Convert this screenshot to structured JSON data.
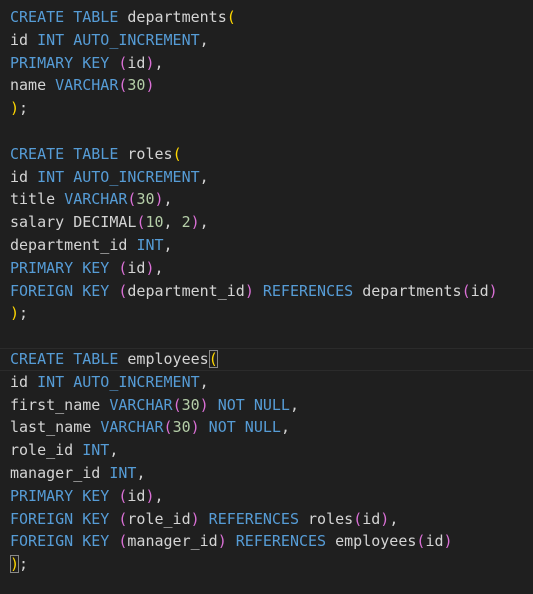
{
  "editor": {
    "language": "SQL",
    "theme": "Dark Modern",
    "current_line_index": 15,
    "lines": [
      [
        {
          "t": "CREATE TABLE ",
          "c": "kw"
        },
        {
          "t": "departments",
          "c": "plain"
        },
        {
          "t": "(",
          "c": "p1"
        }
      ],
      [
        {
          "t": "id ",
          "c": "plain"
        },
        {
          "t": "INT AUTO_INCREMENT",
          "c": "kw"
        },
        {
          "t": ",",
          "c": "plain"
        }
      ],
      [
        {
          "t": "PRIMARY KEY ",
          "c": "kw"
        },
        {
          "t": "(",
          "c": "p2"
        },
        {
          "t": "id",
          "c": "plain"
        },
        {
          "t": ")",
          "c": "p2"
        },
        {
          "t": ",",
          "c": "plain"
        }
      ],
      [
        {
          "t": "name ",
          "c": "plain"
        },
        {
          "t": "VARCHAR",
          "c": "kw"
        },
        {
          "t": "(",
          "c": "p2"
        },
        {
          "t": "30",
          "c": "num"
        },
        {
          "t": ")",
          "c": "p2"
        }
      ],
      [
        {
          "t": ")",
          "c": "p1"
        },
        {
          "t": ";",
          "c": "plain"
        }
      ],
      [],
      [
        {
          "t": "CREATE TABLE ",
          "c": "kw"
        },
        {
          "t": "roles",
          "c": "plain"
        },
        {
          "t": "(",
          "c": "p1"
        }
      ],
      [
        {
          "t": "id ",
          "c": "plain"
        },
        {
          "t": "INT AUTO_INCREMENT",
          "c": "kw"
        },
        {
          "t": ",",
          "c": "plain"
        }
      ],
      [
        {
          "t": "title ",
          "c": "plain"
        },
        {
          "t": "VARCHAR",
          "c": "kw"
        },
        {
          "t": "(",
          "c": "p2"
        },
        {
          "t": "30",
          "c": "num"
        },
        {
          "t": ")",
          "c": "p2"
        },
        {
          "t": ",",
          "c": "plain"
        }
      ],
      [
        {
          "t": "salary DECIMAL",
          "c": "plain"
        },
        {
          "t": "(",
          "c": "p2"
        },
        {
          "t": "10",
          "c": "num"
        },
        {
          "t": ", ",
          "c": "plain"
        },
        {
          "t": "2",
          "c": "num"
        },
        {
          "t": ")",
          "c": "p2"
        },
        {
          "t": ",",
          "c": "plain"
        }
      ],
      [
        {
          "t": "department_id ",
          "c": "plain"
        },
        {
          "t": "INT",
          "c": "kw"
        },
        {
          "t": ",",
          "c": "plain"
        }
      ],
      [
        {
          "t": "PRIMARY KEY ",
          "c": "kw"
        },
        {
          "t": "(",
          "c": "p2"
        },
        {
          "t": "id",
          "c": "plain"
        },
        {
          "t": ")",
          "c": "p2"
        },
        {
          "t": ",",
          "c": "plain"
        }
      ],
      [
        {
          "t": "FOREIGN KEY ",
          "c": "kw"
        },
        {
          "t": "(",
          "c": "p2"
        },
        {
          "t": "department_id",
          "c": "plain"
        },
        {
          "t": ")",
          "c": "p2"
        },
        {
          "t": " REFERENCES ",
          "c": "kw"
        },
        {
          "t": "departments",
          "c": "plain"
        },
        {
          "t": "(",
          "c": "p2"
        },
        {
          "t": "id",
          "c": "plain"
        },
        {
          "t": ")",
          "c": "p2"
        }
      ],
      [
        {
          "t": ")",
          "c": "p1"
        },
        {
          "t": ";",
          "c": "plain"
        }
      ],
      [],
      [
        {
          "t": "CREATE TABLE ",
          "c": "kw"
        },
        {
          "t": "employees",
          "c": "plain"
        },
        {
          "t": "(",
          "c": "p1",
          "m": 1
        }
      ],
      [
        {
          "t": "id ",
          "c": "plain"
        },
        {
          "t": "INT AUTO_INCREMENT",
          "c": "kw"
        },
        {
          "t": ",",
          "c": "plain"
        }
      ],
      [
        {
          "t": "first_name ",
          "c": "plain"
        },
        {
          "t": "VARCHAR",
          "c": "kw"
        },
        {
          "t": "(",
          "c": "p2"
        },
        {
          "t": "30",
          "c": "num"
        },
        {
          "t": ")",
          "c": "p2"
        },
        {
          "t": " NOT NULL",
          "c": "kw"
        },
        {
          "t": ",",
          "c": "plain"
        }
      ],
      [
        {
          "t": "last_name ",
          "c": "plain"
        },
        {
          "t": "VARCHAR",
          "c": "kw"
        },
        {
          "t": "(",
          "c": "p2"
        },
        {
          "t": "30",
          "c": "num"
        },
        {
          "t": ")",
          "c": "p2"
        },
        {
          "t": " NOT NULL",
          "c": "kw"
        },
        {
          "t": ",",
          "c": "plain"
        }
      ],
      [
        {
          "t": "role_id ",
          "c": "plain"
        },
        {
          "t": "INT",
          "c": "kw"
        },
        {
          "t": ",",
          "c": "plain"
        }
      ],
      [
        {
          "t": "manager_id ",
          "c": "plain"
        },
        {
          "t": "INT",
          "c": "kw"
        },
        {
          "t": ",",
          "c": "plain"
        }
      ],
      [
        {
          "t": "PRIMARY KEY ",
          "c": "kw"
        },
        {
          "t": "(",
          "c": "p2"
        },
        {
          "t": "id",
          "c": "plain"
        },
        {
          "t": ")",
          "c": "p2"
        },
        {
          "t": ",",
          "c": "plain"
        }
      ],
      [
        {
          "t": "FOREIGN KEY ",
          "c": "kw"
        },
        {
          "t": "(",
          "c": "p2"
        },
        {
          "t": "role_id",
          "c": "plain"
        },
        {
          "t": ")",
          "c": "p2"
        },
        {
          "t": " REFERENCES ",
          "c": "kw"
        },
        {
          "t": "roles",
          "c": "plain"
        },
        {
          "t": "(",
          "c": "p2"
        },
        {
          "t": "id",
          "c": "plain"
        },
        {
          "t": ")",
          "c": "p2"
        },
        {
          "t": ",",
          "c": "plain"
        }
      ],
      [
        {
          "t": "FOREIGN KEY ",
          "c": "kw"
        },
        {
          "t": "(",
          "c": "p2"
        },
        {
          "t": "manager_id",
          "c": "plain"
        },
        {
          "t": ")",
          "c": "p2"
        },
        {
          "t": " REFERENCES ",
          "c": "kw"
        },
        {
          "t": "employees",
          "c": "plain"
        },
        {
          "t": "(",
          "c": "p2"
        },
        {
          "t": "id",
          "c": "plain"
        },
        {
          "t": ")",
          "c": "p2"
        }
      ],
      [
        {
          "t": ")",
          "c": "p1",
          "m": 1
        },
        {
          "t": ";",
          "c": "plain"
        }
      ]
    ]
  },
  "colors": {
    "background": "#1f1f1f",
    "keyword": "#569cd6",
    "identifier": "#d4d4d4",
    "number": "#b5cea8",
    "bracket_level_1": "#ffd700",
    "bracket_level_2": "#da70d6"
  }
}
